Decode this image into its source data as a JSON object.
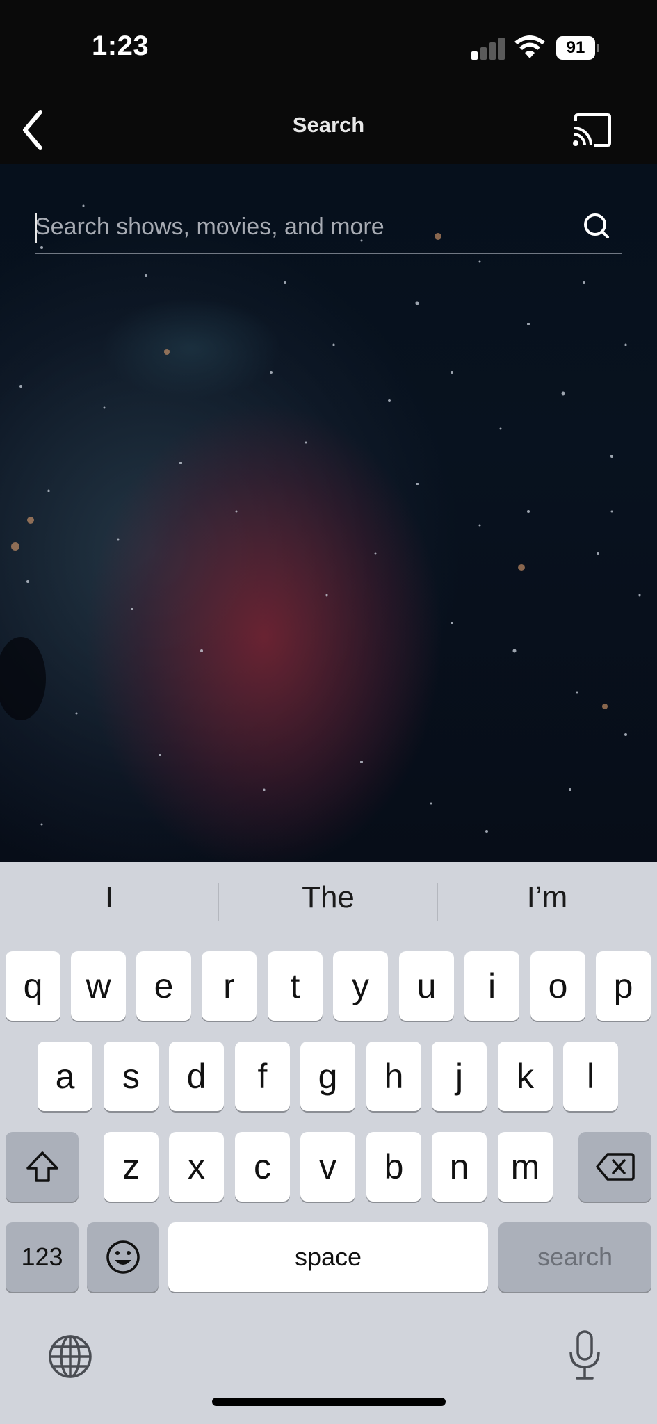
{
  "status_bar": {
    "time": "1:23",
    "battery": "91"
  },
  "header": {
    "title": "Search"
  },
  "search": {
    "placeholder": "Search shows, movies, and more",
    "value": ""
  },
  "keyboard": {
    "suggestions": [
      "I",
      "The",
      "I’m"
    ],
    "row1": [
      "q",
      "w",
      "e",
      "r",
      "t",
      "y",
      "u",
      "i",
      "o",
      "p"
    ],
    "row2": [
      "a",
      "s",
      "d",
      "f",
      "g",
      "h",
      "j",
      "k",
      "l"
    ],
    "row3": [
      "z",
      "x",
      "c",
      "v",
      "b",
      "n",
      "m"
    ],
    "numbers_label": "123",
    "space_label": "space",
    "search_label": "search"
  },
  "icons": {
    "back": "chevron-left-icon",
    "cast": "cast-icon",
    "search": "search-icon",
    "shift": "shift-icon",
    "delete": "backspace-icon",
    "emoji": "emoji-icon",
    "globe": "globe-icon",
    "mic": "microphone-icon"
  },
  "colors": {
    "keyboard_bg": "#d1d4db",
    "key_bg": "#ffffff",
    "fn_key_bg": "#abb0ba",
    "app_bg": "#0a0a0a"
  }
}
